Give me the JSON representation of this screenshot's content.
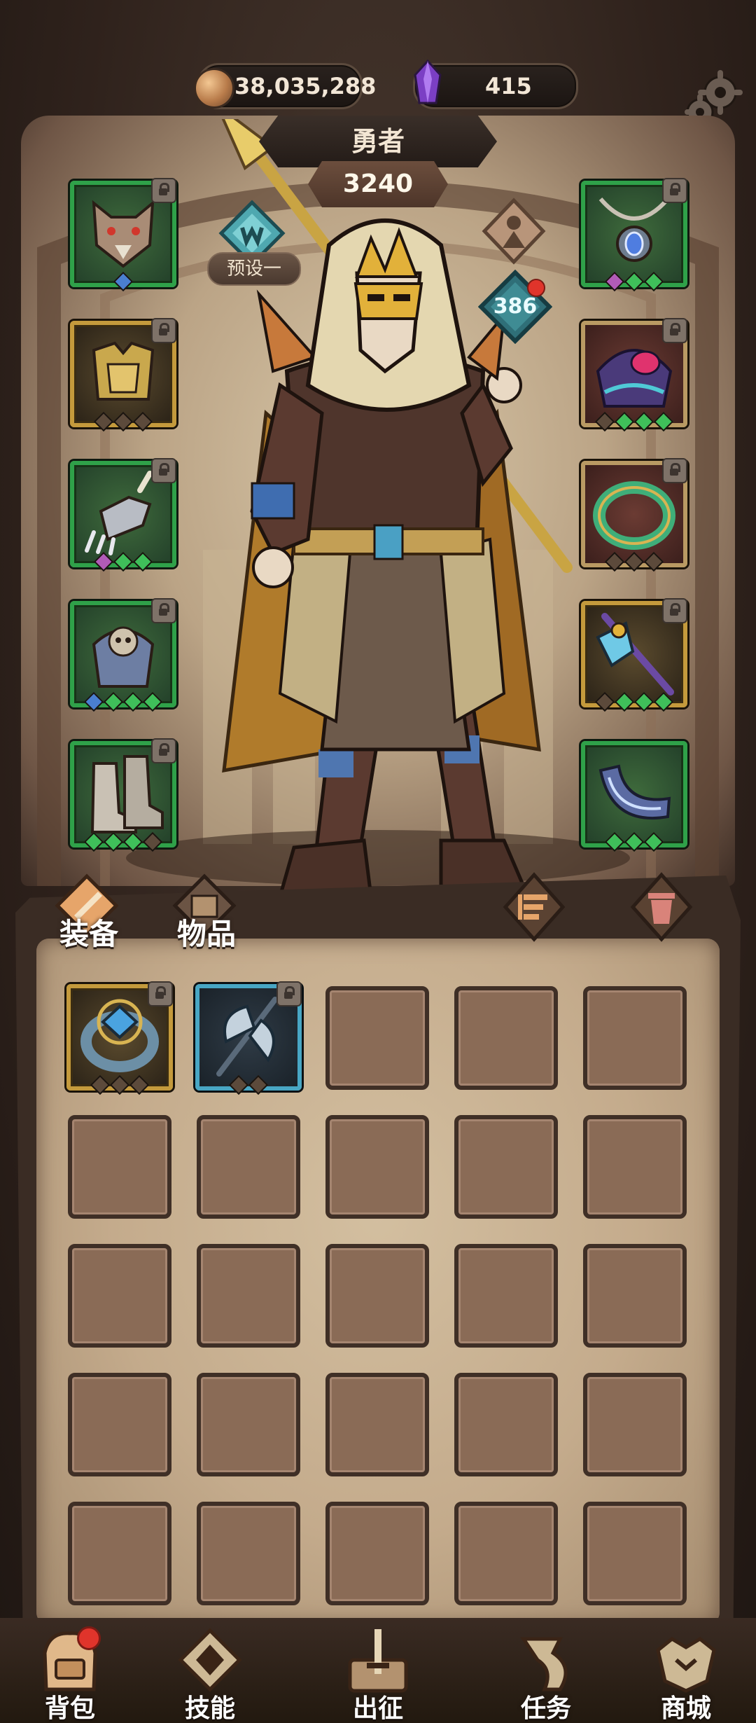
{
  "currency": {
    "gold": "38,035,288",
    "gems": "415"
  },
  "hero": {
    "name": "勇者",
    "power": "3240",
    "preset_label": "预设一",
    "level": "386"
  },
  "equipment_left": [
    {
      "item": "wolf-helm-icon",
      "rarity": "green",
      "locked": true
    },
    {
      "item": "gold-armor-icon",
      "rarity": "gold",
      "locked": true
    },
    {
      "item": "claw-gauntlet-icon",
      "rarity": "green",
      "locked": true
    },
    {
      "item": "beast-pauldron-icon",
      "rarity": "green",
      "locked": true
    },
    {
      "item": "boots-icon",
      "rarity": "green",
      "locked": true
    }
  ],
  "equipment_right": [
    {
      "item": "amulet-icon",
      "rarity": "green",
      "locked": true
    },
    {
      "item": "dark-helm-icon",
      "rarity": "red",
      "locked": true
    },
    {
      "item": "jade-ring-icon",
      "rarity": "red",
      "locked": true
    },
    {
      "item": "staff-icon",
      "rarity": "gold",
      "locked": true
    },
    {
      "item": "horn-icon",
      "rarity": "green",
      "locked": false
    }
  ],
  "bag": {
    "tabs": [
      {
        "label": "装备",
        "active": true
      },
      {
        "label": "物品",
        "active": false
      }
    ],
    "items": [
      {
        "item": "sapphire-ring-icon",
        "rarity": "gold",
        "locked": true
      },
      {
        "item": "battle-axe-icon",
        "rarity": "blue",
        "locked": true
      }
    ],
    "empty_slots": 23
  },
  "nav": [
    {
      "label": "背包",
      "icon": "backpack-icon",
      "active": true,
      "dot": true
    },
    {
      "label": "技能",
      "icon": "skill-book-icon",
      "active": false
    },
    {
      "label": "出征",
      "icon": "expedition-sword-icon",
      "active": false
    },
    {
      "label": "任务",
      "icon": "quest-horn-icon",
      "active": false
    },
    {
      "label": "商城",
      "icon": "shop-crest-icon",
      "active": false
    }
  ],
  "colors": {
    "rarity_green": "#2fa149",
    "rarity_gold": "#c49a3c",
    "rarity_blue": "#48a6c4",
    "notification_red": "#e0342b"
  }
}
